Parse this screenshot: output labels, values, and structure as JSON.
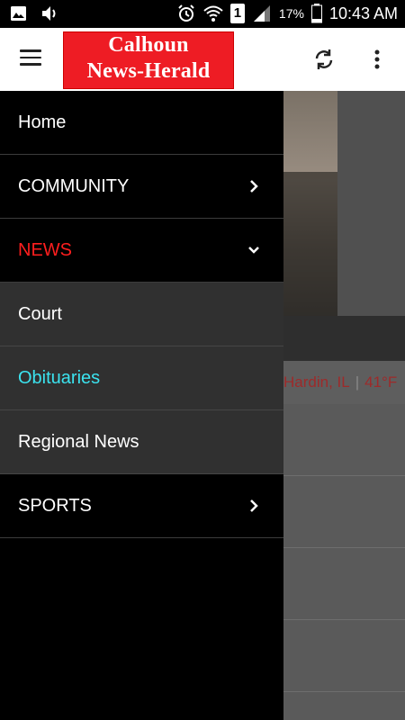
{
  "status_bar": {
    "battery_percent": "17%",
    "time": "10:43 AM",
    "sim_label": "1",
    "icons": [
      "image-icon",
      "volume-icon",
      "alarm-icon",
      "wifi-icon",
      "sim-icon",
      "signal-icon",
      "battery-icon"
    ]
  },
  "toolbar": {
    "logo_line1": "Calhoun",
    "logo_line2": "News-Herald",
    "menu_icon": "hamburger-icon",
    "refresh_icon": "refresh-icon",
    "overflow_icon": "more-vert-icon",
    "accent_color": "#ee1c24"
  },
  "background": {
    "location": "Hardin, IL",
    "temperature": "41°F"
  },
  "drawer": {
    "items": [
      {
        "label": "Home",
        "type": "link"
      },
      {
        "label": "COMMUNITY",
        "type": "expandable",
        "expanded": false
      },
      {
        "label": "NEWS",
        "type": "expandable",
        "expanded": true,
        "color": "#ff1e1e"
      },
      {
        "label": "Court",
        "type": "subitem"
      },
      {
        "label": "Obituaries",
        "type": "subitem",
        "color": "#3be3ef"
      },
      {
        "label": "Regional News",
        "type": "subitem"
      },
      {
        "label": "SPORTS",
        "type": "expandable",
        "expanded": false
      }
    ]
  }
}
